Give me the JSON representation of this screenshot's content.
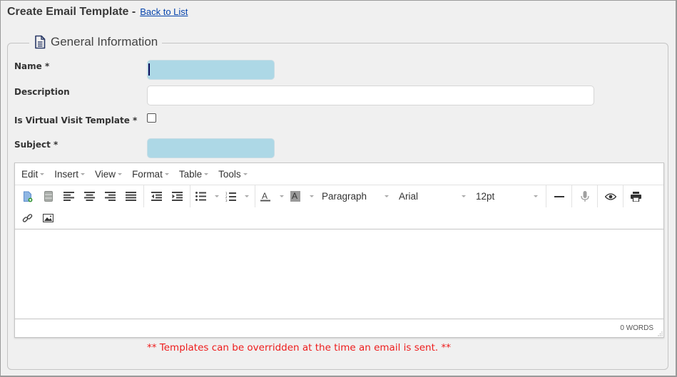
{
  "header": {
    "title": "Create Email Template -",
    "back_link": "Back to List"
  },
  "section": {
    "legend": "General Information",
    "legend_icon": "document-icon"
  },
  "form": {
    "name": {
      "label": "Name *",
      "value": "",
      "required": true
    },
    "description": {
      "label": "Description",
      "value": ""
    },
    "is_virtual_visit": {
      "label": "Is Virtual Visit Template *",
      "checked": false
    },
    "subject": {
      "label": "Subject *",
      "value": "",
      "required": true
    }
  },
  "colors": {
    "required_field_bg": "#add8e6",
    "note_text": "#ee1c1c",
    "link": "#0645ad"
  },
  "editor": {
    "menus": [
      "Edit",
      "Insert",
      "View",
      "Format",
      "Table",
      "Tools"
    ],
    "toolbar": {
      "buttons": [
        "new-document-icon",
        "template-icon",
        "align-left-icon",
        "align-center-icon",
        "align-right-icon",
        "align-justify-icon",
        "outdent-icon",
        "indent-icon",
        "bullet-list-icon",
        "numbered-list-icon",
        "text-color-icon",
        "background-color-icon",
        "horizontal-rule-icon",
        "microphone-icon",
        "preview-icon",
        "print-icon",
        "link-icon",
        "image-icon"
      ],
      "block_format": "Paragraph",
      "font_family": "Arial",
      "font_size": "12pt"
    },
    "content": "",
    "word_count": "0 WORDS"
  },
  "note": "** Templates can be overridden at the time an email is sent. **"
}
